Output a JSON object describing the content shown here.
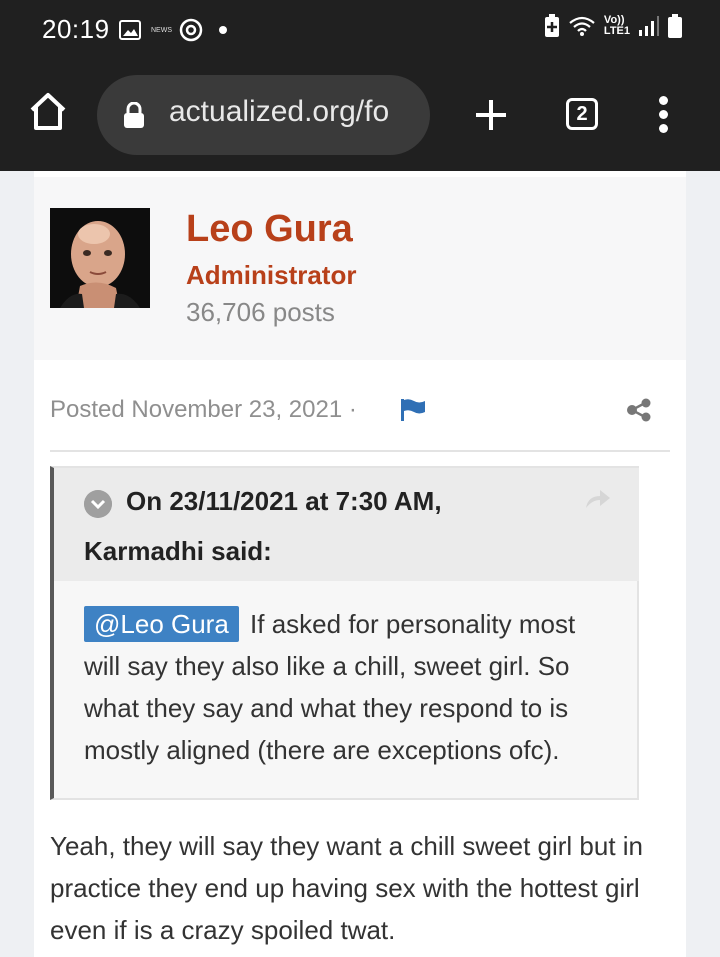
{
  "status_bar": {
    "time": "20:19",
    "left_icons": [
      "image-icon",
      "news-icon",
      "sync-icon",
      "notification-dot"
    ],
    "news_label": "NEWS",
    "right_icons": [
      "battery-saver-icon",
      "wifi-icon",
      "signal-icon",
      "battery-icon"
    ],
    "network_label_top": "Vo))",
    "network_label_bottom": "LTE1"
  },
  "browser": {
    "url": "actualized.org/fo",
    "tab_count": "2"
  },
  "author": {
    "name": "Leo Gura",
    "role": "Administrator",
    "posts": "36,706 posts"
  },
  "post": {
    "meta": "Posted November 23, 2021 ·",
    "quote": {
      "cite_line1": "On 23/11/2021 at 7:30 AM,",
      "cite_line2": "Karmadhi said:",
      "mention": "@Leo Gura",
      "text": "If asked for personality most will say they also like a chill, sweet girl. So what they say and what they respond to is mostly aligned (there are exceptions ofc)."
    },
    "reply": "Yeah, they will say they want a chill sweet girl but in practice they end up having sex with the hottest girl even if is a crazy spoiled twat."
  },
  "colors": {
    "brand": "#b8401a",
    "mention_bg": "#3e82c4",
    "chrome_bg": "#202020"
  }
}
